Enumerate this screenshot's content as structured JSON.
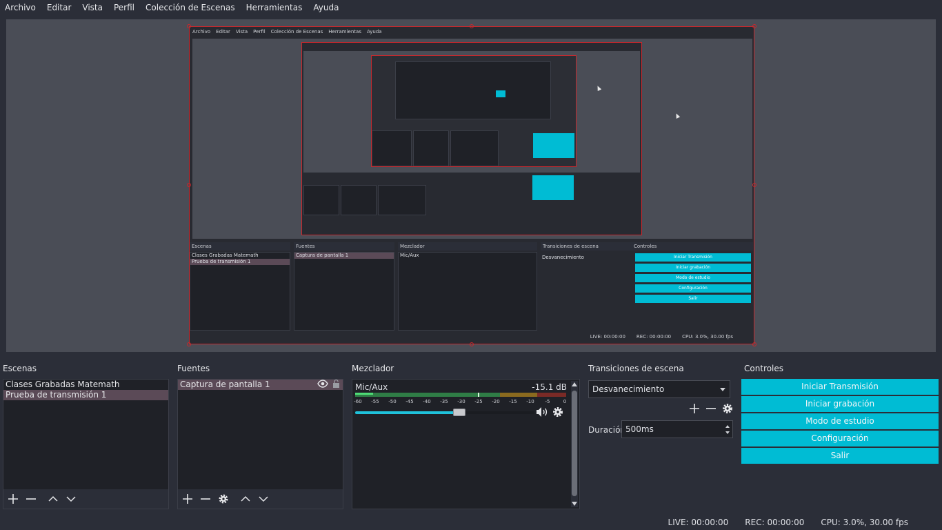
{
  "menu": [
    "Archivo",
    "Editar",
    "Vista",
    "Perfil",
    "Colección de Escenas",
    "Herramientas",
    "Ayuda"
  ],
  "docks": {
    "scenes": {
      "title": "Escenas",
      "items": [
        "Clases Grabadas Matemath",
        "Prueba de transmisión 1"
      ],
      "selected_index": 1
    },
    "sources": {
      "title": "Fuentes",
      "items": [
        "Captura de pantalla 1"
      ]
    },
    "mixer": {
      "title": "Mezclador",
      "channel": "Mic/Aux",
      "level": "-15.1 dB",
      "ticks": [
        "-60",
        "-55",
        "-50",
        "-45",
        "-40",
        "-35",
        "-30",
        "-25",
        "-20",
        "-15",
        "-10",
        "-5",
        "0"
      ],
      "fader_fraction": 0.58
    },
    "transitions": {
      "title": "Transiciones de escena",
      "selected": "Desvanecimiento",
      "duration_label": "Duración",
      "duration_value": "500ms"
    },
    "controls": {
      "title": "Controles",
      "buttons": [
        "Iniciar Transmisión",
        "Iniciar grabación",
        "Modo de estudio",
        "Configuración",
        "Salir"
      ]
    }
  },
  "status": {
    "live": "LIVE: 00:00:00",
    "rec": "REC: 00:00:00",
    "cpu": "CPU: 3.0%, 30.00 fps"
  },
  "colors": {
    "accent": "#00bcd4",
    "selection": "#5b4a57",
    "bounding_box": "#c8282d",
    "background": "#2b2e38"
  },
  "icons": [
    "plus-icon",
    "minus-icon",
    "chevron-up-icon",
    "chevron-down-icon",
    "gear-icon",
    "eye-icon",
    "lock-icon",
    "speaker-icon"
  ]
}
